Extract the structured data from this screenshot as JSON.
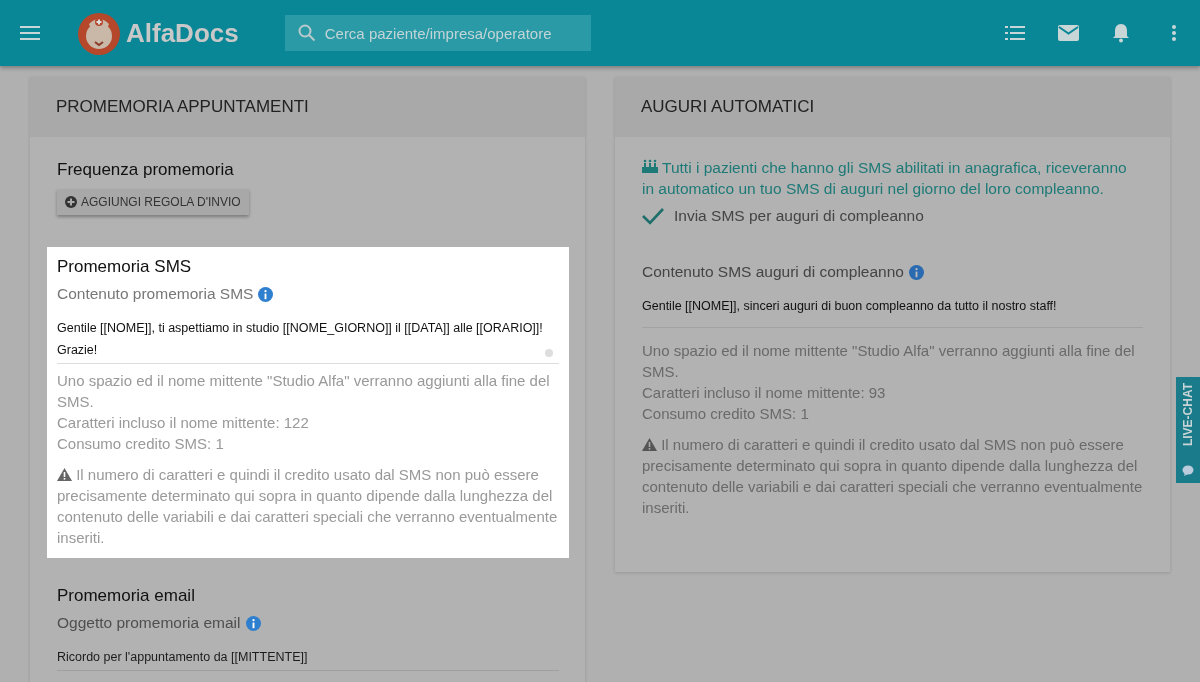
{
  "header": {
    "logo_text": "AlfaDocs",
    "search": {
      "placeholder": "Cerca paziente/impresa/operatore"
    }
  },
  "left_card": {
    "title": "PROMEMORIA APPUNTAMENTI",
    "subtitle": "Frequenza promemoria",
    "add_button": "AGGIUNGI REGOLA D'INVIO",
    "sections": [
      {
        "title": "Promemoria SMS",
        "highlighted": true,
        "field_label": "Contenuto promemoria SMS",
        "value": "Gentile [[NOME]], ti aspettiamo in studio [[NOME_GIORNO]] il [[DATA]] alle [[ORARIO]]! Grazie!",
        "resizable": true,
        "notes": [
          "Uno spazio ed il nome mittente \"Studio Alfa\" verranno aggiunti alla fine del SMS.",
          "Caratteri incluso il nome mittente: 122",
          "Consumo credito SMS: 1"
        ],
        "warning": "Il numero di caratteri e quindi il credito usato dal SMS non può essere precisamente determinato qui sopra in quanto dipende dalla lunghezza del contenuto delle variabili e dai caratteri speciali che verranno eventualmente inseriti."
      },
      {
        "title": "Promemoria email",
        "highlighted": false,
        "field_label": "Oggetto promemoria email",
        "value": "Ricordo per l'appuntamento da [[MITTENTE]]",
        "resizable": false
      }
    ]
  },
  "right_card": {
    "title": "AUGURI AUTOMATICI",
    "info": "Tutti i pazienti che hanno gli SMS abilitati in anagrafica, riceveranno in automatico un tuo SMS di auguri nel giorno del loro compleanno.",
    "checkbox": {
      "label": "Invia SMS per auguri di compleanno",
      "checked": true
    },
    "field_label": "Contenuto SMS auguri di compleanno",
    "value": "Gentile [[NOME]], sinceri auguri di buon compleanno da tutto il nostro staff!",
    "notes": [
      "Uno spazio ed il nome mittente \"Studio Alfa\" verranno aggiunti alla fine del SMS.",
      "Caratteri incluso il nome mittente: 93",
      "Consumo credito SMS: 1"
    ],
    "warning": "Il numero di caratteri e quindi il credito usato dal SMS non può essere precisamente determinato qui sopra in quanto dipende dalla lunghezza del contenuto delle variabili e dai caratteri speciali che verranno eventualmente inseriti."
  },
  "live_chat": {
    "label": "LIVE-CHAT"
  }
}
